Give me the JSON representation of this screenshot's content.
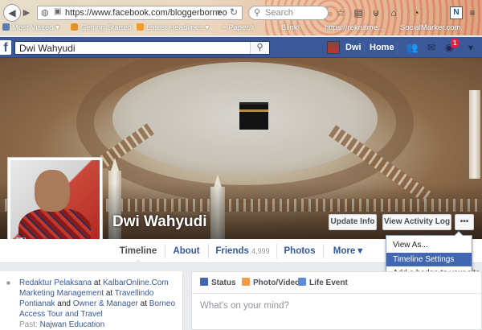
{
  "browser": {
    "url": "https://www.facebook.com/bloggerborneo",
    "search_placeholder": "Search",
    "bookmarks": [
      "Most Visited",
      "Getting Started",
      "Latest Headlines",
      "+ Paper.li",
      "Blink!",
      "https://rekrutme...",
      "SocialMarker.com"
    ]
  },
  "fb_header": {
    "logo": "f",
    "search_value": "Dwi Wahyudi",
    "user_name": "Dwi",
    "home_label": "Home",
    "notification_count": "1"
  },
  "profile": {
    "name": "Dwi Wahyudi",
    "update_info_label": "Update Info",
    "activity_log_label": "View Activity Log",
    "more_dots_label": "•••"
  },
  "tabs": {
    "timeline": "Timeline",
    "about": "About",
    "friends": "Friends",
    "friends_count": "4,999",
    "photos": "Photos",
    "more": "More ▾"
  },
  "dropdown": {
    "items": [
      "View As...",
      "Timeline Settings",
      "Add a badge to your site"
    ],
    "selected": "Timeline Settings"
  },
  "intro": {
    "line1_a": "Redaktur Pelaksana",
    "line1_b": " at ",
    "line1_c": "KalbarOnline.Com",
    "line2_a": "Marketing Management",
    "line2_b": " at ",
    "line2_c": "Travellindo",
    "line3_a": "Pontianak",
    "line3_b": " and ",
    "line3_c": "Owner & Manager",
    "line3_d": " at ",
    "line3_e": "Borneo",
    "line4_a": "Access Tour and Travel",
    "line5_a": "Past: ",
    "line5_b": "Najwan Education"
  },
  "composer": {
    "status_label": "Status",
    "photo_label": "Photo/Video",
    "event_label": "Life Event",
    "placeholder": "What's on your mind?"
  },
  "colors": {
    "fb_blue": "#3b5998",
    "link": "#365899",
    "menu_highlight": "#4267b2"
  }
}
